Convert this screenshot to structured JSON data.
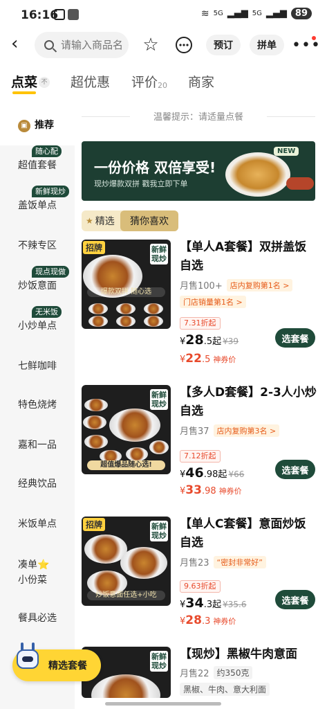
{
  "status": {
    "time": "16:16",
    "signal1": "5G",
    "signal2": "5G",
    "battery": "89"
  },
  "header": {
    "search_placeholder": "请输入商品名",
    "book_label": "预订",
    "group_label": "拼单"
  },
  "tabs": [
    {
      "label": "点菜",
      "badge": "不"
    },
    {
      "label": "超优惠"
    },
    {
      "label": "评价",
      "count": "20"
    },
    {
      "label": "商家"
    }
  ],
  "sidebar": {
    "items": [
      {
        "label": "推荐"
      },
      {
        "label": "超值套餐",
        "tag": "随心配"
      },
      {
        "label": "盖饭单点",
        "tag": "新鲜现炒"
      },
      {
        "label": "不辣专区"
      },
      {
        "label": "炒饭意面",
        "tag": "现点现做"
      },
      {
        "label": "小炒单点",
        "tag": "无米饭"
      },
      {
        "label": "七鲜咖啡"
      },
      {
        "label": "特色烧烤"
      },
      {
        "label": "嘉和一品"
      },
      {
        "label": "经典饮品"
      },
      {
        "label": "米饭单点"
      },
      {
        "label": "凑单⭐小份菜"
      },
      {
        "label": "餐具必选"
      }
    ]
  },
  "notice": "温馨提示：请适量点餐",
  "banner": {
    "title": "一份价格 双倍享受!",
    "subtitle": "现炒爆款双拼 戳我立即下单",
    "new_badge": "NEW"
  },
  "filter": {
    "selected": "精选",
    "guess": "猜你喜欢"
  },
  "products": [
    {
      "name": "【单人A套餐】双拼盖饭自选",
      "sales": "月售100+",
      "tags": [
        "店内复购第1名 >",
        "门店销量第1名 >"
      ],
      "discount": "7.31折起",
      "price_int": "28",
      "price_dec": ".5",
      "price_suffix": "起",
      "orig_price": "¥39",
      "coupon_int": "22",
      "coupon_dec": ".5",
      "coupon_label": "神券价",
      "button": "选套餐",
      "img_badge": "招牌",
      "img_fresh": "新鲜现炒",
      "img_caption": "爆款双拼 随心选"
    },
    {
      "name": "【多人D套餐】2-3人小炒自选",
      "sales": "月售37",
      "tags": [
        "店内复购第3名 >"
      ],
      "discount": "7.12折起",
      "price_int": "46",
      "price_dec": ".98",
      "price_suffix": "起",
      "orig_price": "¥66",
      "coupon_int": "33",
      "coupon_dec": ".98",
      "coupon_label": "神券价",
      "button": "选套餐",
      "img_badge": "",
      "img_fresh": "新鲜现炒",
      "img_caption": "超值爆品随心选!"
    },
    {
      "name": "【单人C套餐】意面炒饭自选",
      "sales": "月售23",
      "tags": [
        "“密封非常好”"
      ],
      "discount": "9.63折起",
      "price_int": "34",
      "price_dec": ".3",
      "price_suffix": "起",
      "orig_price": "¥35.6",
      "coupon_int": "28",
      "coupon_dec": ".3",
      "coupon_label": "神券价",
      "button": "选套餐",
      "img_badge": "招牌",
      "img_fresh": "新鲜现炒",
      "img_caption": "炒饭意面任选+小吃"
    },
    {
      "name": "【现炒】黑椒牛肉意面",
      "sales": "月售22",
      "tags": [
        "约350克"
      ],
      "extra": "黑椒、牛肉、意大利面",
      "img_fresh": "新鲜现炒"
    }
  ],
  "float_button": "精选套餐",
  "colors": {
    "brand_green": "#1f4b3a",
    "accent_yellow": "#ffc300",
    "price_red": "#e84a2c"
  }
}
